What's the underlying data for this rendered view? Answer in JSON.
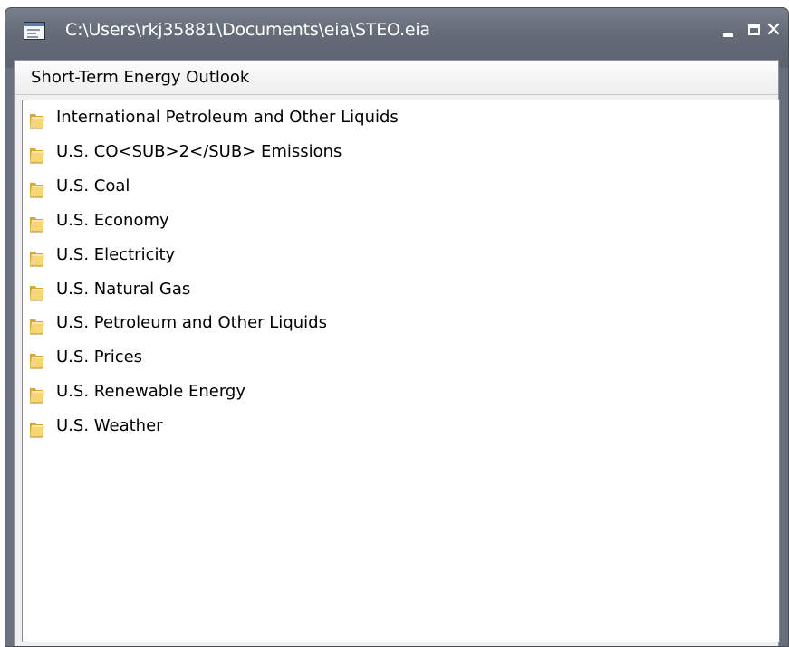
{
  "window": {
    "title": "C:\\Users\\rkj35881\\Documents\\eia\\STEO.eia",
    "controls": {
      "minimize_icon": "minimize-icon",
      "maximize_icon": "maximize-icon",
      "close_label": "✕"
    }
  },
  "header": {
    "title": "Short-Term Energy Outlook"
  },
  "tree": {
    "item_icon": "folder-icon",
    "items": [
      {
        "label": "International Petroleum and Other Liquids"
      },
      {
        "label": "U.S. CO<SUB>2</SUB> Emissions"
      },
      {
        "label": "U.S. Coal"
      },
      {
        "label": "U.S. Economy"
      },
      {
        "label": "U.S. Electricity"
      },
      {
        "label": "U.S. Natural Gas"
      },
      {
        "label": "U.S. Petroleum and Other Liquids"
      },
      {
        "label": "U.S. Prices"
      },
      {
        "label": "U.S. Renewable Energy"
      },
      {
        "label": "U.S. Weather"
      }
    ]
  },
  "colors": {
    "titlebar": "#5f6772",
    "title_text": "#ffffff",
    "folder_light": "#f7d773",
    "folder_dark": "#d6a63c",
    "list_background": "#ffffff"
  }
}
